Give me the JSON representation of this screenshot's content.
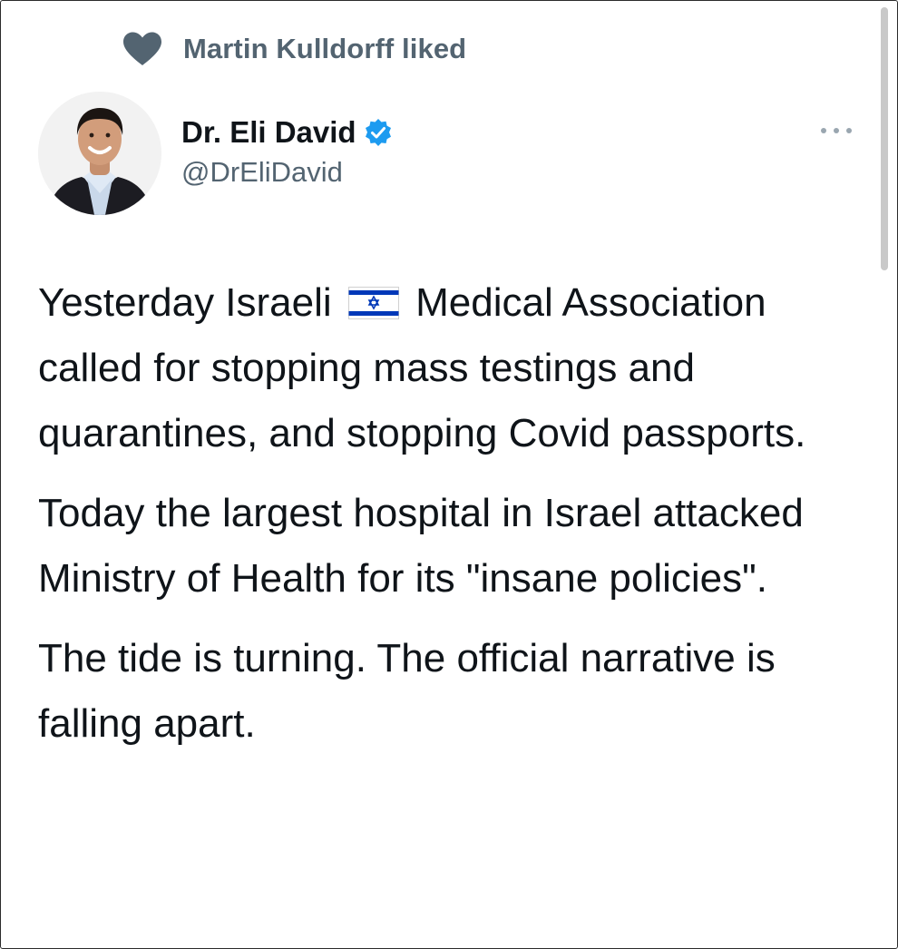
{
  "social_context": {
    "icon": "heart-icon",
    "text": "Martin Kulldorff liked"
  },
  "author": {
    "name": "Dr. Eli David",
    "handle": "@DrEliDavid",
    "verified": true,
    "avatar": "profile-photo"
  },
  "menu": {
    "icon": "more-options-icon"
  },
  "tweet": {
    "paragraph1_before_flag": "Yesterday Israeli",
    "flag": "israel-flag-emoji",
    "paragraph1_after_flag": "Medical Association called for stopping mass testings and quarantines, and stopping Covid passports.",
    "paragraph2": "Today the largest hospital in Israel attacked Ministry of Health for its \"insane policies\".",
    "paragraph3": "The tide is turning. The official narrative is falling apart."
  },
  "colors": {
    "text_primary": "#0f1419",
    "text_secondary": "#536471",
    "verified_blue": "#1d9bf0",
    "flag_blue": "#0038b8"
  }
}
